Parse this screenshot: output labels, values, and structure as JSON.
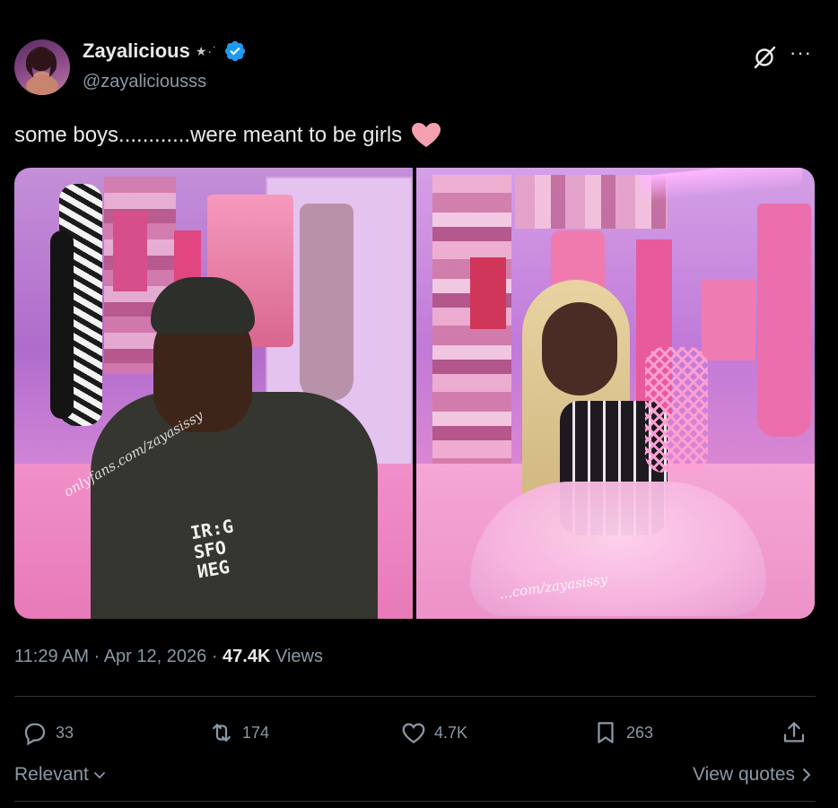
{
  "post": {
    "author": {
      "display_name": "Zayalicious",
      "name_decoration": "★·˙",
      "handle": "@zayaliciousss",
      "verified": true
    },
    "text": "some boys............were meant to be girls",
    "text_emoji": "pink-heart-icon",
    "media": {
      "left_watermark": "onlyfans.com/zayasissy",
      "right_watermark": "...com/zayasissy",
      "left_hoodie_text": [
        "IR:G",
        "SFO",
        "ИEG"
      ]
    },
    "timestamp": "11:29 AM",
    "date": "Apr 12, 2026",
    "separator": "·",
    "views_count": "47.4K",
    "views_label": "Views"
  },
  "actions": {
    "replies": "33",
    "reposts": "174",
    "likes": "4.7K",
    "bookmarks": "263"
  },
  "footer": {
    "sort_label": "Relevant",
    "view_quotes_label": "View quotes"
  },
  "colors": {
    "background": "#000000",
    "text_primary": "#e7e9ea",
    "text_secondary": "#8b98a5",
    "verified_blue": "#1d9bf0",
    "divider": "#2f3336",
    "heart_pink": "#f4a0b0"
  }
}
